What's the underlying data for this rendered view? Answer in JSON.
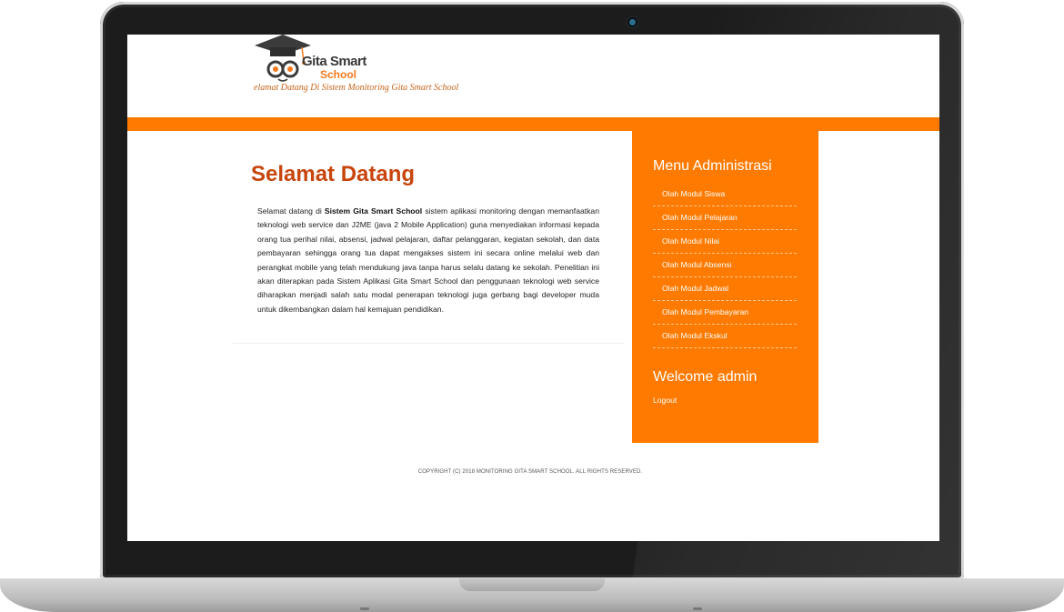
{
  "site": {
    "logo_line1": "Gita Smart",
    "logo_line2": "School",
    "tagline": "elamat Datang Di Sistem Monitoring Gita Smart School"
  },
  "main": {
    "title": "Selamat Datang",
    "intro_prefix": "Selamat datang di ",
    "intro_bold": "Sistem Gita Smart School",
    "intro_rest": " sistem aplikasi monitoring dengan memanfaatkan teknologi web service dan J2ME (java 2 Mobile Application) guna menyediakan informasi kepada orang tua perihal nilai, absensi, jadwal pelajaran, daftar pelanggaran, kegiatan sekolah, dan data pembayaran sehingga orang tua dapat mengakses sistem ini secara online melalui web dan perangkat mobile yang telah mendukung java tanpa harus selalu datang ke sekolah. Penelitian ini akan diterapkan pada Sistem Aplikasi Gita Smart School dan penggunaan teknologi web service diharapkan menjadi salah satu modal penerapan teknologi juga gerbang bagi developer muda untuk dikembangkan dalam hal kemajuan pendidikan."
  },
  "sidebar": {
    "menu_title": "Menu Administrasi",
    "items": [
      {
        "label": "Olah Modul Siswa"
      },
      {
        "label": "Olah Modul Pelajaran"
      },
      {
        "label": "Olah Modul Nilai"
      },
      {
        "label": "Olah Modul Absensi"
      },
      {
        "label": "Olah Modul Jadwal"
      },
      {
        "label": "Olah Modul Pembayaran"
      },
      {
        "label": "Olah Modul Ekskul"
      }
    ],
    "welcome": "Welcome admin",
    "logout": "Logout"
  },
  "footer": {
    "copyright": "COPYRIGHT (C) 2018 MONITORING GITA SMART SCHOOL. ALL RIGHTS RESERVED."
  },
  "colors": {
    "accent": "#ff7a00",
    "title": "#c8450c",
    "laptop_bezel": "#1c1c1c"
  },
  "icons": {
    "logo": "graduation-cap-owl-logo-icon",
    "camera": "webcam-icon"
  }
}
